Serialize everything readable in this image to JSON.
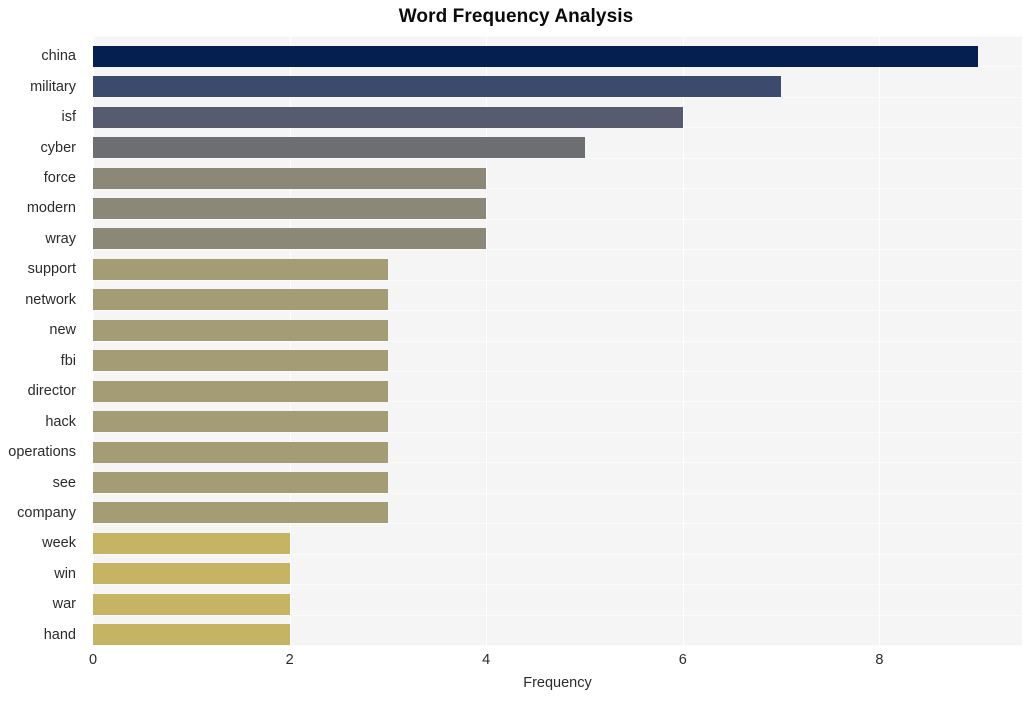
{
  "chart_data": {
    "type": "bar",
    "orientation": "horizontal",
    "title": "Word Frequency Analysis",
    "xlabel": "Frequency",
    "ylabel": "",
    "xlim": [
      0,
      9.45
    ],
    "xticks": [
      0,
      2,
      4,
      6,
      8
    ],
    "xtick_labels": [
      "0",
      "2",
      "4",
      "6",
      "8"
    ],
    "grid": true,
    "legend": false,
    "categories": [
      "china",
      "military",
      "isf",
      "cyber",
      "force",
      "modern",
      "wray",
      "support",
      "network",
      "new",
      "fbi",
      "director",
      "hack",
      "operations",
      "see",
      "company",
      "week",
      "win",
      "war",
      "hand"
    ],
    "values": [
      9,
      7,
      6,
      5,
      4,
      4,
      4,
      3,
      3,
      3,
      3,
      3,
      3,
      3,
      3,
      3,
      2,
      2,
      2,
      2
    ],
    "bar_colors": [
      "#052050",
      "#3c4a6e",
      "#565b70",
      "#6d6e72",
      "#8b8878",
      "#8b8878",
      "#8b8878",
      "#a49c75",
      "#a49c75",
      "#a49c75",
      "#a49c75",
      "#a49c75",
      "#a49c75",
      "#a49c75",
      "#a49c75",
      "#a49c75",
      "#c4b463",
      "#c4b463",
      "#c4b463",
      "#c4b463"
    ],
    "plot_background": "#f5f5f6",
    "grid_color": "#ffffff",
    "title_color": "#0b0b0b",
    "tick_color": "#2b2b2b"
  }
}
